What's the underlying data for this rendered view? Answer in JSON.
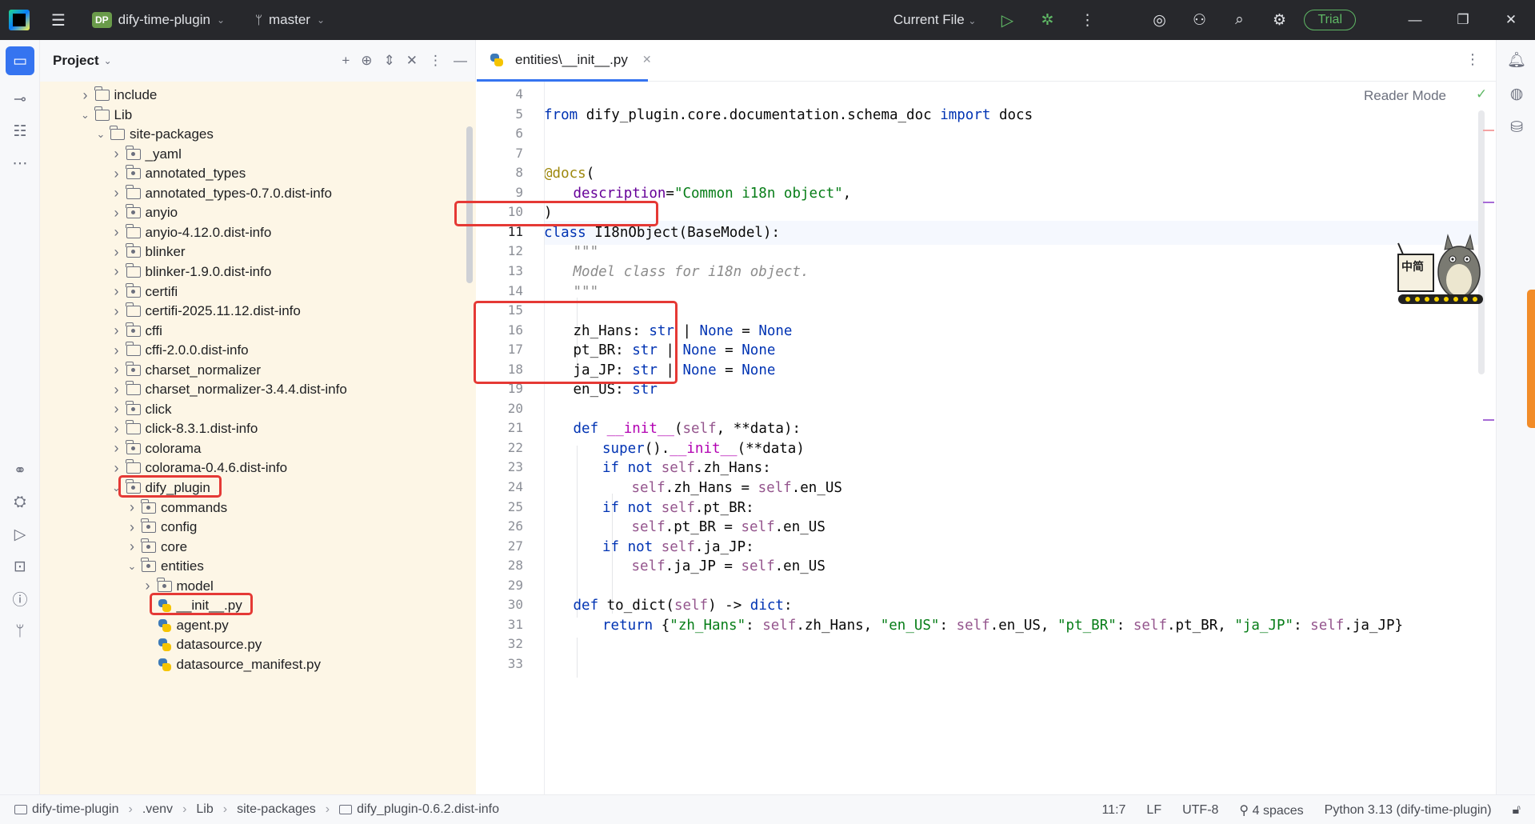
{
  "titlebar": {
    "project_badge": "DP",
    "project_name": "dify-time-plugin",
    "branch": "master",
    "run_config": "Current File",
    "trial_label": "Trial"
  },
  "project_panel": {
    "title": "Project",
    "tree": [
      {
        "label": "include",
        "depth": 3,
        "expanded": false,
        "icon": "folder"
      },
      {
        "label": "Lib",
        "depth": 3,
        "expanded": true,
        "icon": "folder"
      },
      {
        "label": "site-packages",
        "depth": 4,
        "expanded": true,
        "icon": "folder"
      },
      {
        "label": "_yaml",
        "depth": 5,
        "expanded": false,
        "icon": "package"
      },
      {
        "label": "annotated_types",
        "depth": 5,
        "expanded": false,
        "icon": "package"
      },
      {
        "label": "annotated_types-0.7.0.dist-info",
        "depth": 5,
        "expanded": false,
        "icon": "folder"
      },
      {
        "label": "anyio",
        "depth": 5,
        "expanded": false,
        "icon": "package"
      },
      {
        "label": "anyio-4.12.0.dist-info",
        "depth": 5,
        "expanded": false,
        "icon": "folder"
      },
      {
        "label": "blinker",
        "depth": 5,
        "expanded": false,
        "icon": "package"
      },
      {
        "label": "blinker-1.9.0.dist-info",
        "depth": 5,
        "expanded": false,
        "icon": "folder"
      },
      {
        "label": "certifi",
        "depth": 5,
        "expanded": false,
        "icon": "package"
      },
      {
        "label": "certifi-2025.11.12.dist-info",
        "depth": 5,
        "expanded": false,
        "icon": "folder"
      },
      {
        "label": "cffi",
        "depth": 5,
        "expanded": false,
        "icon": "package"
      },
      {
        "label": "cffi-2.0.0.dist-info",
        "depth": 5,
        "expanded": false,
        "icon": "folder"
      },
      {
        "label": "charset_normalizer",
        "depth": 5,
        "expanded": false,
        "icon": "package"
      },
      {
        "label": "charset_normalizer-3.4.4.dist-info",
        "depth": 5,
        "expanded": false,
        "icon": "folder"
      },
      {
        "label": "click",
        "depth": 5,
        "expanded": false,
        "icon": "package"
      },
      {
        "label": "click-8.3.1.dist-info",
        "depth": 5,
        "expanded": false,
        "icon": "folder"
      },
      {
        "label": "colorama",
        "depth": 5,
        "expanded": false,
        "icon": "package"
      },
      {
        "label": "colorama-0.4.6.dist-info",
        "depth": 5,
        "expanded": false,
        "icon": "folder"
      },
      {
        "label": "dify_plugin",
        "depth": 5,
        "expanded": true,
        "icon": "package",
        "highlight": true
      },
      {
        "label": "commands",
        "depth": 6,
        "expanded": false,
        "icon": "package"
      },
      {
        "label": "config",
        "depth": 6,
        "expanded": false,
        "icon": "package"
      },
      {
        "label": "core",
        "depth": 6,
        "expanded": false,
        "icon": "package"
      },
      {
        "label": "entities",
        "depth": 6,
        "expanded": true,
        "icon": "package"
      },
      {
        "label": "model",
        "depth": 7,
        "expanded": false,
        "icon": "package"
      },
      {
        "label": "__init__.py",
        "depth": 7,
        "expanded": null,
        "icon": "python",
        "highlight": true
      },
      {
        "label": "agent.py",
        "depth": 7,
        "expanded": null,
        "icon": "python"
      },
      {
        "label": "datasource.py",
        "depth": 7,
        "expanded": null,
        "icon": "python"
      },
      {
        "label": "datasource_manifest.py",
        "depth": 7,
        "expanded": null,
        "icon": "python"
      }
    ]
  },
  "editor": {
    "tab_label": "entities\\__init__.py",
    "reader_mode": "Reader Mode",
    "current_line": 11,
    "lines": [
      {
        "n": "4",
        "indent": 0,
        "tokens": []
      },
      {
        "n": "5",
        "indent": 0,
        "tokens": [
          [
            "kw",
            "from"
          ],
          [
            "p",
            " dify_plugin.core.documentation.schema_doc "
          ],
          [
            "kw",
            "import"
          ],
          [
            "p",
            " docs"
          ]
        ]
      },
      {
        "n": "6",
        "indent": 0,
        "tokens": []
      },
      {
        "n": "7",
        "indent": 0,
        "tokens": []
      },
      {
        "n": "8",
        "indent": 0,
        "tokens": [
          [
            "dec",
            "@docs"
          ],
          [
            "p",
            "("
          ]
        ]
      },
      {
        "n": "9",
        "indent": 1,
        "tokens": [
          [
            "kwarg",
            "description"
          ],
          [
            "p",
            "="
          ],
          [
            "str",
            "\"Common i18n object\""
          ],
          [
            "p",
            ","
          ]
        ]
      },
      {
        "n": "10",
        "indent": 0,
        "tokens": [
          [
            "p",
            ")"
          ]
        ]
      },
      {
        "n": "11",
        "indent": 0,
        "tokens": [
          [
            "kw",
            "class"
          ],
          [
            "p",
            " I18nObject(BaseModel):"
          ]
        ]
      },
      {
        "n": "12",
        "indent": 1,
        "tokens": [
          [
            "cmt",
            "\"\"\""
          ]
        ]
      },
      {
        "n": "13",
        "indent": 1,
        "tokens": [
          [
            "cmt",
            "Model class for i18n object."
          ]
        ]
      },
      {
        "n": "14",
        "indent": 1,
        "tokens": [
          [
            "cmt",
            "\"\"\""
          ]
        ]
      },
      {
        "n": "15",
        "indent": 0,
        "tokens": []
      },
      {
        "n": "16",
        "indent": 1,
        "tokens": [
          [
            "p",
            "zh_Hans: "
          ],
          [
            "kw",
            "str"
          ],
          [
            "p",
            " | "
          ],
          [
            "kw",
            "None"
          ],
          [
            "p",
            " = "
          ],
          [
            "kw",
            "None"
          ]
        ]
      },
      {
        "n": "17",
        "indent": 1,
        "tokens": [
          [
            "p",
            "pt_BR: "
          ],
          [
            "kw",
            "str"
          ],
          [
            "p",
            " | "
          ],
          [
            "kw",
            "None"
          ],
          [
            "p",
            " = "
          ],
          [
            "kw",
            "None"
          ]
        ]
      },
      {
        "n": "18",
        "indent": 1,
        "tokens": [
          [
            "p",
            "ja_JP: "
          ],
          [
            "kw",
            "str"
          ],
          [
            "p",
            " | "
          ],
          [
            "kw",
            "None"
          ],
          [
            "p",
            " = "
          ],
          [
            "kw",
            "None"
          ]
        ]
      },
      {
        "n": "19",
        "indent": 1,
        "tokens": [
          [
            "p",
            "en_US: "
          ],
          [
            "kw",
            "str"
          ]
        ]
      },
      {
        "n": "20",
        "indent": 0,
        "tokens": []
      },
      {
        "n": "21",
        "indent": 1,
        "tokens": [
          [
            "kw",
            "def"
          ],
          [
            "p",
            " "
          ],
          [
            "mag",
            "__init__"
          ],
          [
            "p",
            "("
          ],
          [
            "self",
            "self"
          ],
          [
            "p",
            ", **data):"
          ]
        ]
      },
      {
        "n": "22",
        "indent": 2,
        "tokens": [
          [
            "kw",
            "super"
          ],
          [
            "p",
            "()."
          ],
          [
            "mag",
            "__init__"
          ],
          [
            "p",
            "(**data)"
          ]
        ]
      },
      {
        "n": "23",
        "indent": 2,
        "tokens": [
          [
            "kw",
            "if not"
          ],
          [
            "p",
            " "
          ],
          [
            "self",
            "self"
          ],
          [
            "p",
            ".zh_Hans:"
          ]
        ]
      },
      {
        "n": "24",
        "indent": 3,
        "tokens": [
          [
            "self",
            "self"
          ],
          [
            "p",
            ".zh_Hans = "
          ],
          [
            "self",
            "self"
          ],
          [
            "p",
            ".en_US"
          ]
        ]
      },
      {
        "n": "25",
        "indent": 2,
        "tokens": [
          [
            "kw",
            "if not"
          ],
          [
            "p",
            " "
          ],
          [
            "self",
            "self"
          ],
          [
            "p",
            ".pt_BR:"
          ]
        ]
      },
      {
        "n": "26",
        "indent": 3,
        "tokens": [
          [
            "self",
            "self"
          ],
          [
            "p",
            ".pt_BR = "
          ],
          [
            "self",
            "self"
          ],
          [
            "p",
            ".en_US"
          ]
        ]
      },
      {
        "n": "27",
        "indent": 2,
        "tokens": [
          [
            "kw",
            "if not"
          ],
          [
            "p",
            " "
          ],
          [
            "self",
            "self"
          ],
          [
            "p",
            ".ja_JP:"
          ]
        ]
      },
      {
        "n": "28",
        "indent": 3,
        "tokens": [
          [
            "self",
            "self"
          ],
          [
            "p",
            ".ja_JP = "
          ],
          [
            "self",
            "self"
          ],
          [
            "p",
            ".en_US"
          ]
        ]
      },
      {
        "n": "29",
        "indent": 0,
        "tokens": []
      },
      {
        "n": "30",
        "indent": 1,
        "tokens": [
          [
            "kw",
            "def"
          ],
          [
            "p",
            " to_dict("
          ],
          [
            "self",
            "self"
          ],
          [
            "p",
            ") -> "
          ],
          [
            "kw",
            "dict"
          ],
          [
            "p",
            ":"
          ]
        ]
      },
      {
        "n": "31",
        "indent": 2,
        "tokens": [
          [
            "kw",
            "return"
          ],
          [
            "p",
            " {"
          ],
          [
            "str",
            "\"zh_Hans\""
          ],
          [
            "p",
            ": "
          ],
          [
            "self",
            "self"
          ],
          [
            "p",
            ".zh_Hans, "
          ],
          [
            "str",
            "\"en_US\""
          ],
          [
            "p",
            ": "
          ],
          [
            "self",
            "self"
          ],
          [
            "p",
            ".en_US, "
          ],
          [
            "str",
            "\"pt_BR\""
          ],
          [
            "p",
            ": "
          ],
          [
            "self",
            "self"
          ],
          [
            "p",
            ".pt_BR, "
          ],
          [
            "str",
            "\"ja_JP\""
          ],
          [
            "p",
            ": "
          ],
          [
            "self",
            "self"
          ],
          [
            "p",
            ".ja_JP}"
          ]
        ]
      },
      {
        "n": "32",
        "indent": 0,
        "tokens": []
      },
      {
        "n": "33",
        "indent": 0,
        "tokens": []
      }
    ]
  },
  "mascot_text": "中简",
  "statusbar": {
    "breadcrumbs": [
      "dify-time-plugin",
      ".venv",
      "Lib",
      "site-packages",
      "dify_plugin-0.6.2.dist-info"
    ],
    "position": "11:7",
    "line_separator": "LF",
    "encoding": "UTF-8",
    "indent": "4 spaces",
    "interpreter": "Python 3.13 (dify-time-plugin)"
  },
  "colors": {
    "keyword": "#0033b3",
    "string": "#067d17",
    "decorator": "#9e880d",
    "self": "#94558d",
    "highlight_box": "#e53935",
    "accent": "#3574f0",
    "trial": "#5fb865"
  }
}
